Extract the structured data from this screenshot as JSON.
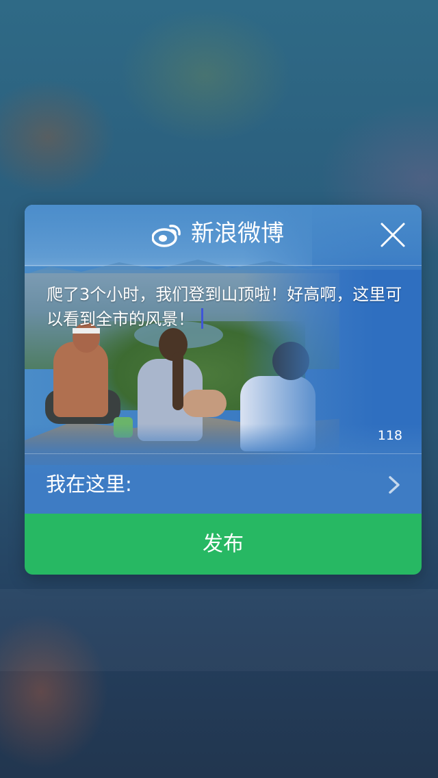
{
  "dialog": {
    "title": "新浪微博",
    "brand_icon": "weibo-icon",
    "close_icon": "close-icon"
  },
  "post": {
    "text": "爬了3个小时，我们登到山顶啦！好高啊，这里可以看到全市的风景！",
    "remaining_chars": "118"
  },
  "location": {
    "label": "我在这里:",
    "icon": "chevron-right-icon"
  },
  "publish": {
    "label": "发布"
  },
  "colors": {
    "dialog_blue": "#3f7fc4",
    "publish_green": "#27b863",
    "caret": "#3f55d8",
    "text": "#ffffff"
  }
}
